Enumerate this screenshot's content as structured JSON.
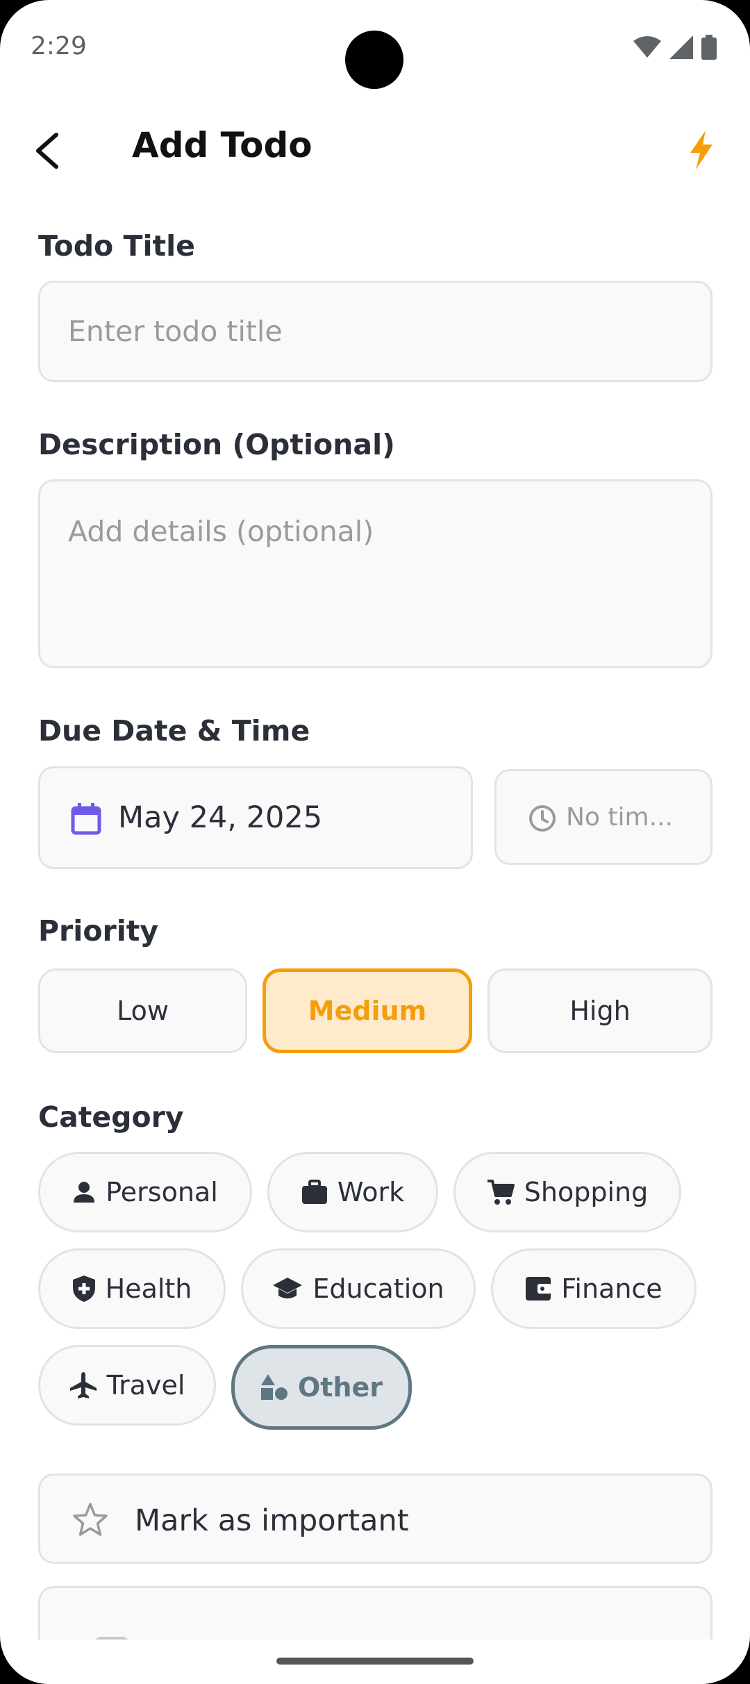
{
  "status": {
    "time": "2:29"
  },
  "header": {
    "title": "Add Todo"
  },
  "title_section": {
    "label": "Todo Title",
    "placeholder": "Enter todo title"
  },
  "description_section": {
    "label": "Description (Optional)",
    "placeholder": "Add details (optional)"
  },
  "due_section": {
    "label": "Due Date & Time",
    "date": "May 24, 2025",
    "time_placeholder": "No tim..."
  },
  "priority_section": {
    "label": "Priority",
    "options": [
      "Low",
      "Medium",
      "High"
    ],
    "selected": "Medium"
  },
  "category_section": {
    "label": "Category",
    "options": [
      "Personal",
      "Work",
      "Shopping",
      "Health",
      "Education",
      "Finance",
      "Travel",
      "Other"
    ],
    "selected": "Other"
  },
  "important": {
    "label": "Mark as important"
  },
  "colors": {
    "accent": "#f59e0b",
    "calendar": "#6d5ce7",
    "selected_category": "#5f7683"
  }
}
